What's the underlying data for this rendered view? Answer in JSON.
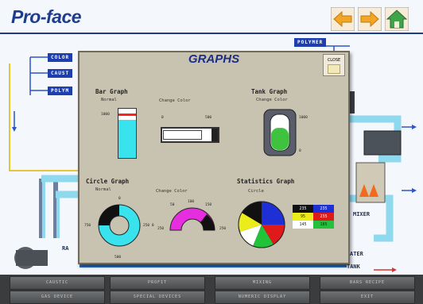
{
  "header": {
    "logo": "Pro-face",
    "nav": [
      {
        "icon": "back-arrow-icon"
      },
      {
        "icon": "forward-arrow-icon"
      },
      {
        "icon": "home-icon"
      }
    ]
  },
  "background": {
    "tags": [
      "COLOR",
      "CAUST",
      "POLYM",
      "POLYMER"
    ],
    "mixer_label": "MIXER",
    "water_label": "ATER",
    "tank_label": "TANK",
    "ra_label": "RA"
  },
  "modal": {
    "title": "GRAPHS",
    "close_label": "CLOSE",
    "bar_graph": {
      "title": "Bar Graph",
      "normal_label": "Normal",
      "change_color_label": "Change Color",
      "max_label": "1000",
      "h_min": "0",
      "h_max": "500",
      "vertical_level": 0.78,
      "horizontal_level": 0.82
    },
    "tank_graph": {
      "title": "Tank Graph",
      "change_color_label": "Change Color",
      "max_label": "1000",
      "min_label": "0",
      "level": 0.62
    },
    "circle_graph": {
      "title": "Circle Graph",
      "normal_label": "Normal",
      "change_color_label": "Change Color",
      "ring_labels": {
        "top": "0",
        "left": "750",
        "right": "250 0",
        "bottom": "500"
      },
      "gauge_labels": {
        "left": "50",
        "center": "100",
        "top_right": "150",
        "right": "250",
        "far_right": "250"
      }
    },
    "statistics_graph": {
      "title": "Statistics Graph",
      "circle_label": "Circle",
      "colors": {
        "black": "#111111",
        "blue": "#1f2fd6",
        "red": "#e01a1a",
        "yellow": "#ecec1a",
        "green": "#22c23a",
        "white": "#ffffff"
      },
      "table": [
        [
          "235",
          "235"
        ],
        [
          "95",
          "235"
        ],
        [
          "145",
          "185"
        ]
      ]
    }
  },
  "bottom_bar": {
    "row1": [
      "CAUSTIC",
      "PROFIT",
      "MIXING",
      "BARS RECIPE"
    ],
    "row2": [
      "GAS DEVICE",
      "SPECIAL DEVICES",
      "NUMERIC DISPLAY",
      "EXIT"
    ]
  }
}
